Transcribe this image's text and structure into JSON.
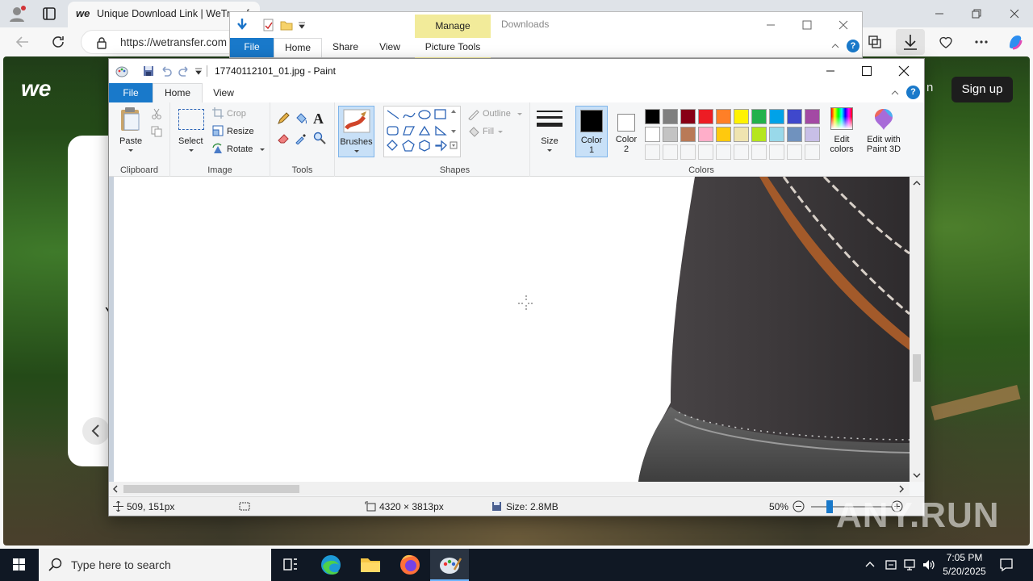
{
  "browser": {
    "tab_title": "Unique Download Link | WeTransfer",
    "url": "https://wetransfer.com",
    "page_logo": "we",
    "signup_label": "Sign up",
    "partial_text_n": "n",
    "partial_text_y": "Y"
  },
  "explorer": {
    "tabs": [
      "File",
      "Home",
      "Share",
      "View"
    ],
    "manage_label": "Manage",
    "picture_tools_label": "Picture Tools",
    "title": "Downloads"
  },
  "paint": {
    "title": "17740112101_01.jpg - Paint",
    "tabs": {
      "file": "File",
      "home": "Home",
      "view": "View"
    },
    "clipboard": {
      "paste": "Paste",
      "group": "Clipboard"
    },
    "image": {
      "select": "Select",
      "crop": "Crop",
      "resize": "Resize",
      "rotate": "Rotate",
      "group": "Image"
    },
    "tools": {
      "group": "Tools"
    },
    "brushes": "Brushes",
    "shapes": {
      "outline": "Outline",
      "fill": "Fill",
      "group": "Shapes"
    },
    "size": "Size",
    "color1": "Color",
    "color1_num": "1",
    "color2": "Color",
    "color2_num": "2",
    "colors_group": "Colors",
    "edit_colors": [
      "Edit",
      "colors"
    ],
    "paint3d": [
      "Edit with",
      "Paint 3D"
    ],
    "palette_row1": [
      "#000000",
      "#7f7f7f",
      "#880015",
      "#ed1c24",
      "#ff7f27",
      "#fff200",
      "#22b14c",
      "#00a2e8",
      "#3f48cc",
      "#a349a4"
    ],
    "palette_row2": [
      "#ffffff",
      "#c3c3c3",
      "#b97a57",
      "#ffaec9",
      "#ffc90e",
      "#efe4b0",
      "#b5e61d",
      "#99d9ea",
      "#7092be",
      "#c8bfe7"
    ],
    "status": {
      "cursor_pos": "509, 151px",
      "dimensions": "4320 × 3813px",
      "size": "Size: 2.8MB",
      "zoom": "50%"
    }
  },
  "taskbar": {
    "search_placeholder": "Type here to search",
    "time": "7:05 PM",
    "date": "5/20/2025"
  },
  "watermark": "ANY.RUN"
}
